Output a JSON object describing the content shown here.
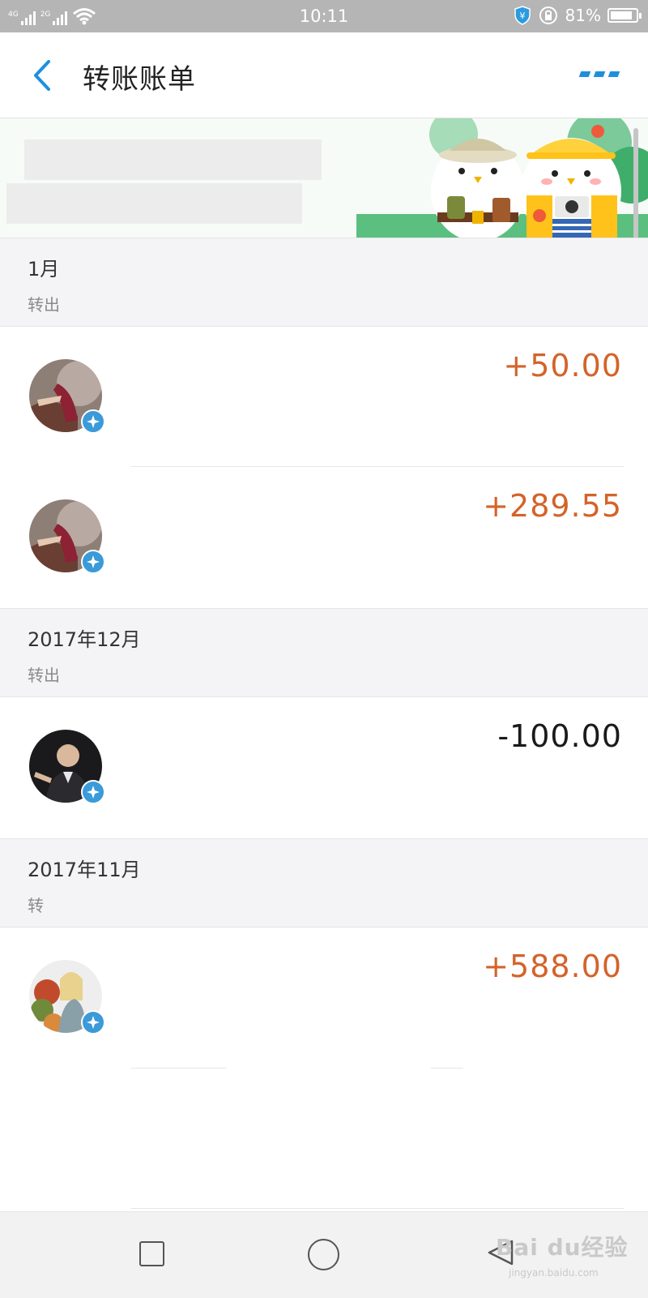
{
  "status_bar": {
    "network_1": "4G",
    "network_2": "2G",
    "time": "10:11",
    "battery": "81%",
    "battery_level": 0.81
  },
  "header": {
    "title": "转账账单"
  },
  "sections": [
    {
      "month": "1月",
      "sub": "转出",
      "rows": [
        {
          "amount": "+50.00",
          "sign": "positive"
        },
        {
          "amount": "+289.55",
          "sign": "positive"
        }
      ]
    },
    {
      "month": "2017年12月",
      "sub": "转出",
      "rows": [
        {
          "amount": "-100.00",
          "sign": "negative"
        }
      ]
    },
    {
      "month": "2017年11月",
      "sub": "转",
      "rows": [
        {
          "amount": "+588.00",
          "sign": "positive"
        }
      ]
    }
  ],
  "watermark": {
    "brand": "Bai du经验",
    "url": "jingyan.baidu.com"
  },
  "colors": {
    "accent": "#1e8fe0",
    "income": "#d4632a",
    "expense": "#1a1a1a",
    "badge": "#3b9ad9"
  }
}
